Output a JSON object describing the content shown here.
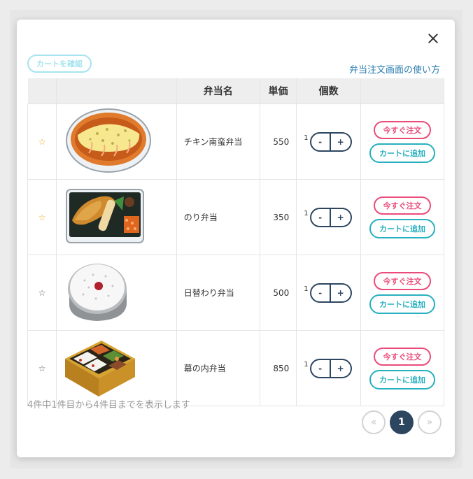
{
  "header": {
    "cart_check_label": "カートを確認",
    "howto_link": "弁当注文画面の使い方"
  },
  "table": {
    "columns": [
      "",
      "",
      "弁当名",
      "単価",
      "個数",
      ""
    ],
    "rows": [
      {
        "favorite": true,
        "image": "chicken-nanban-bento-image",
        "name": "チキン南蛮弁当",
        "price": "550",
        "qty": "1"
      },
      {
        "favorite": true,
        "image": "nori-bento-image",
        "name": "のり弁当",
        "price": "350",
        "qty": "1"
      },
      {
        "favorite": false,
        "image": "daily-bento-image",
        "name": "日替わり弁当",
        "price": "500",
        "qty": "1"
      },
      {
        "favorite": false,
        "image": "makunouchi-bento-image",
        "name": "幕の内弁当",
        "price": "850",
        "qty": "1"
      }
    ],
    "minus_label": "-",
    "plus_label": "+",
    "order_now_label": "今すぐ注文",
    "add_to_cart_label": "カートに追加"
  },
  "footer": {
    "summary": "4件中1件目から4件目までを表示します",
    "pager": {
      "prev": "«",
      "current": "1",
      "next": "»"
    }
  },
  "colors": {
    "star_active": "#f5a623",
    "star_inactive": "#555b66",
    "order_pink": "#ea4c7a",
    "cart_teal": "#27b0bf",
    "navy": "#2c4660",
    "link_blue": "#2a7db0"
  }
}
